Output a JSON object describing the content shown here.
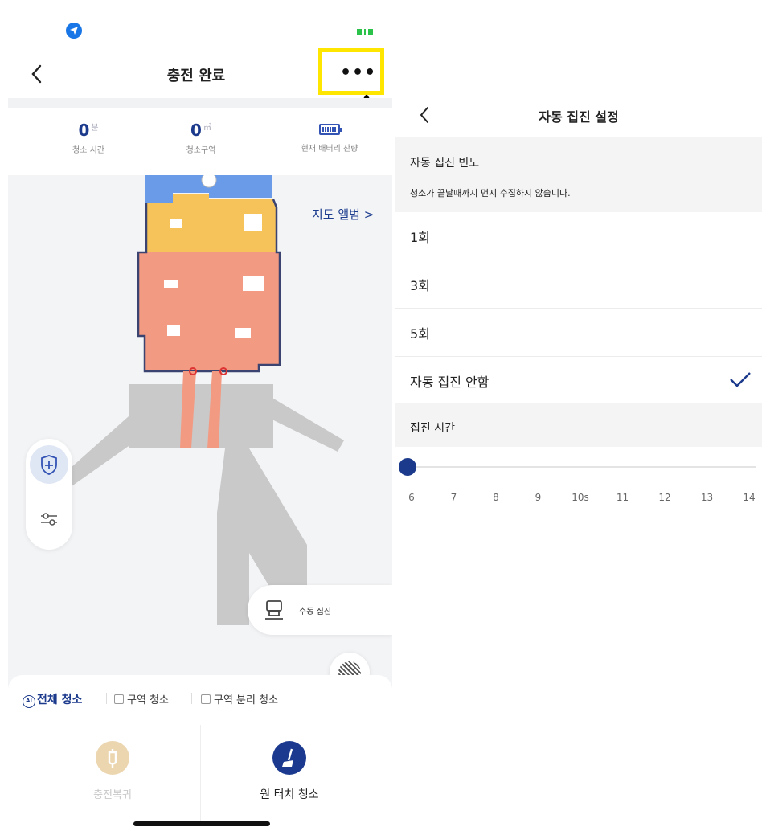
{
  "left_screen": {
    "title": "충전 완료",
    "more_label": "•••",
    "stats": {
      "time_value": "0",
      "time_unit": "분",
      "time_label": "청소 시간",
      "area_value": "0",
      "area_unit": "㎡",
      "area_label": "청소구역",
      "battery_label": "현재 배터리 잔량"
    },
    "map_album_link": "지도 앨범 >",
    "manual_collect_label": "수동 집진",
    "modes": {
      "full_icon": "AI",
      "full": "전체 청소",
      "zone": "구역 청소",
      "split": "구역 분리 청소"
    },
    "bottom": {
      "dock_label": "충전복귀",
      "onetouch_label": "원 터치 청소"
    },
    "colors": {
      "primary": "#1c3a8c",
      "highlight": "#ffe600",
      "map_blue": "#6a9be8",
      "map_yellow": "#f6c35a",
      "map_salmon": "#f39a83",
      "map_gray": "#c9c9c9"
    },
    "icons": [
      "location-icon",
      "battery-icon",
      "back-icon",
      "more-icon",
      "up-arrow-annotation",
      "shield-icon",
      "sliders-icon",
      "manual-collect-icon",
      "hatch-icon",
      "ai-icon",
      "dock-icon",
      "broom-icon"
    ]
  },
  "right_screen": {
    "title": "자동 집진 설정",
    "section1_title": "자동 집진 빈도",
    "section1_desc": "청소가 끝날때까지 먼지 수집하지 않습니다.",
    "options": [
      {
        "label": "1회",
        "selected": false
      },
      {
        "label": "3회",
        "selected": false
      },
      {
        "label": "5회",
        "selected": false
      },
      {
        "label": "자동 집진 안함",
        "selected": true
      }
    ],
    "section2_title": "집진 시간",
    "slider": {
      "ticks": [
        "6",
        "7",
        "8",
        "9",
        "10s",
        "11",
        "12",
        "13",
        "14"
      ],
      "value": "6"
    }
  }
}
